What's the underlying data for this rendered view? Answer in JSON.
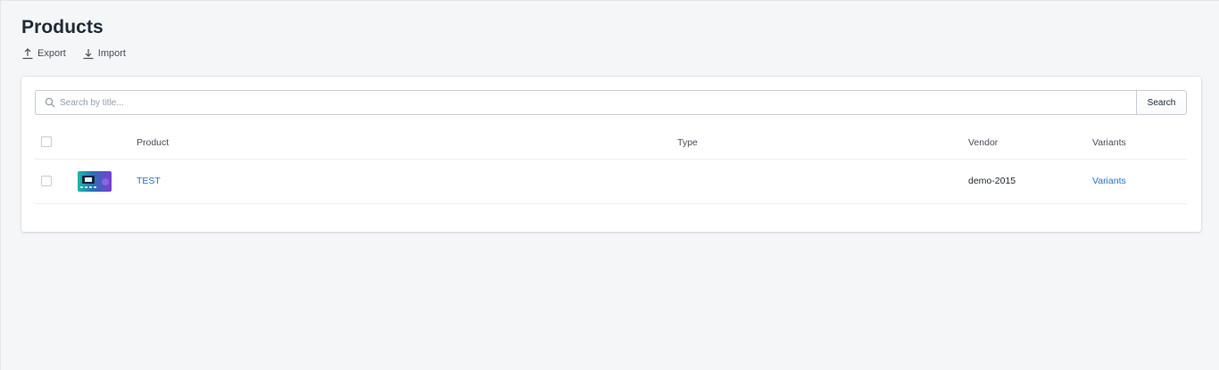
{
  "page": {
    "title": "Products"
  },
  "actions": [
    {
      "label": "Export",
      "icon": "upload-icon"
    },
    {
      "label": "Import",
      "icon": "download-icon"
    }
  ],
  "search": {
    "placeholder": "Search by title...",
    "button_label": "Search",
    "icon": "search-icon"
  },
  "table": {
    "columns": [
      "Product",
      "Type",
      "Vendor",
      "Variants"
    ],
    "rows": [
      {
        "product": "TEST",
        "type": "",
        "vendor": "demo-2015",
        "variants": "Variants",
        "thumbnail": "product-thumbnail"
      }
    ]
  },
  "colors": {
    "link": "#2c6ecb",
    "background": "#f4f6f8",
    "card": "#ffffff",
    "border": "#c4cdd5"
  }
}
